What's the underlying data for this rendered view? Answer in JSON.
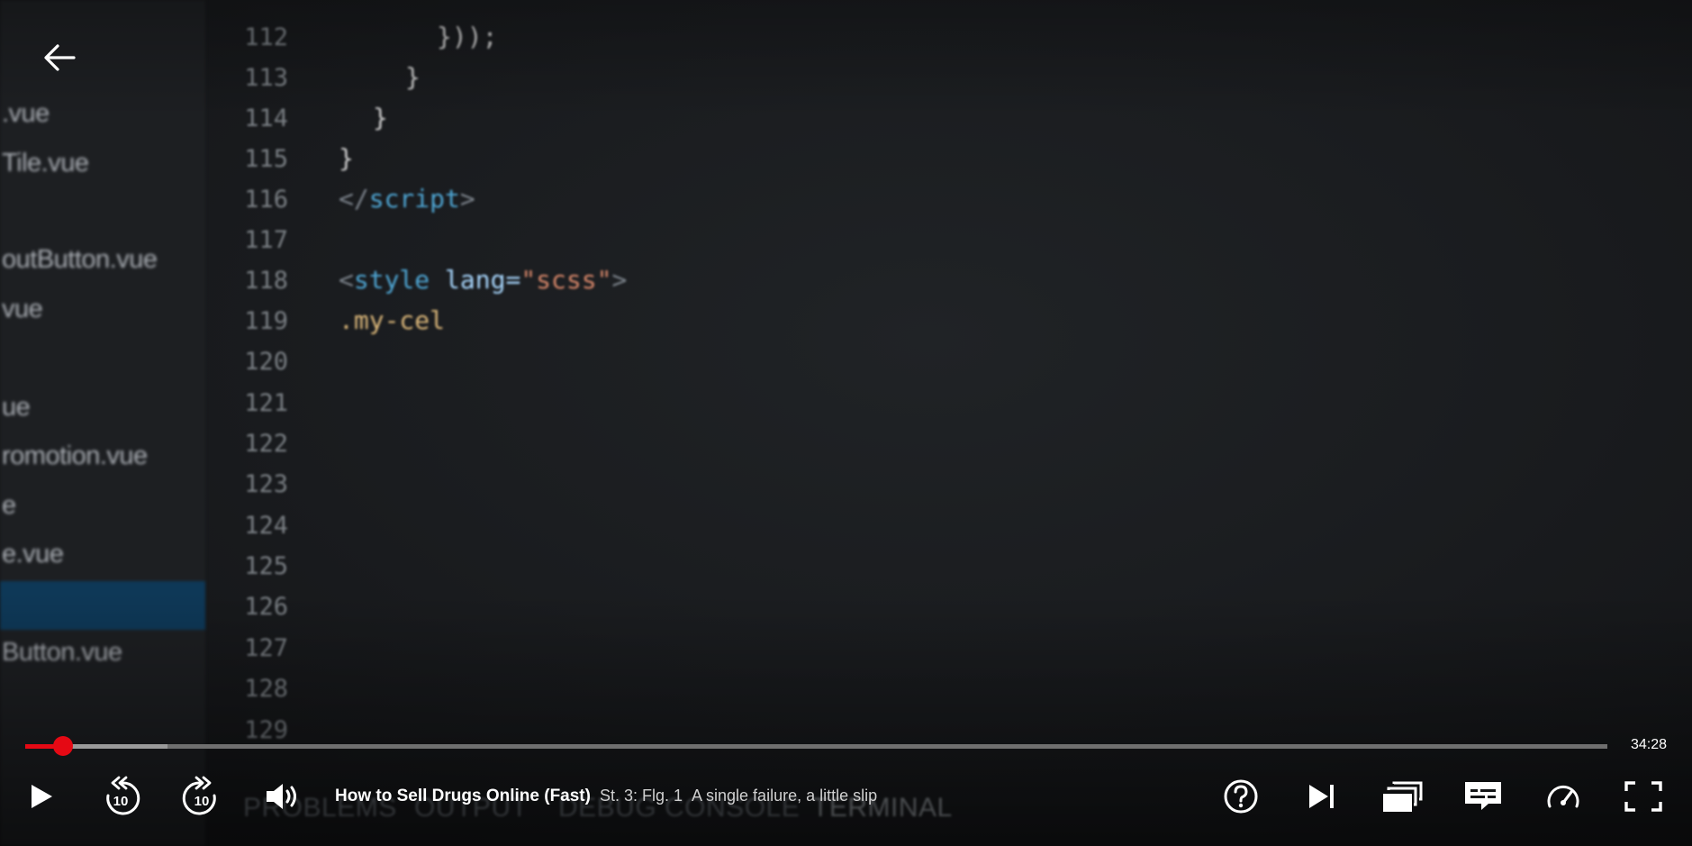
{
  "video_frame": {
    "sidebar_files": [
      ".vue",
      "Tile.vue",
      "outButton.vue",
      "vue",
      "ue",
      "romotion.vue",
      "e",
      "e.vue",
      "Button.vue"
    ],
    "line_numbers": [
      "112",
      "113",
      "114",
      "115",
      "116",
      "117",
      "118",
      "119",
      "120",
      "121",
      "122",
      "123",
      "124",
      "125",
      "126",
      "127",
      "128",
      "129"
    ],
    "code": {
      "l112": "}));",
      "l113": "}",
      "l114": "}",
      "l115": "}",
      "l116_open": "</",
      "l116_kw": "script",
      "l116_close": ">",
      "l118_open": "<",
      "l118_kw": "style",
      "l118_attr": "lang=",
      "l118_str": "\"scss\"",
      "l118_close": ">",
      "l119": ".my-cel"
    },
    "panel_tabs": [
      "PROBLEMS",
      "OUTPUT",
      "DEBUG CONSOLE",
      "TERMINAL"
    ]
  },
  "player": {
    "progress_fraction": 0.024,
    "buffered_fraction": 0.09,
    "time_remaining": "34:28",
    "show_title": "How to Sell Drugs Online (Fast)",
    "episode_number": "St. 3: Flg. 1",
    "episode_title": "A single failure, a little slip",
    "accent_color": "#e50914",
    "icons": [
      "back-arrow-icon",
      "play-icon",
      "rewind-10-icon",
      "forward-10-icon",
      "volume-icon",
      "help-icon",
      "next-episode-icon",
      "episodes-icon",
      "subtitles-icon",
      "speed-icon",
      "fullscreen-icon"
    ]
  }
}
